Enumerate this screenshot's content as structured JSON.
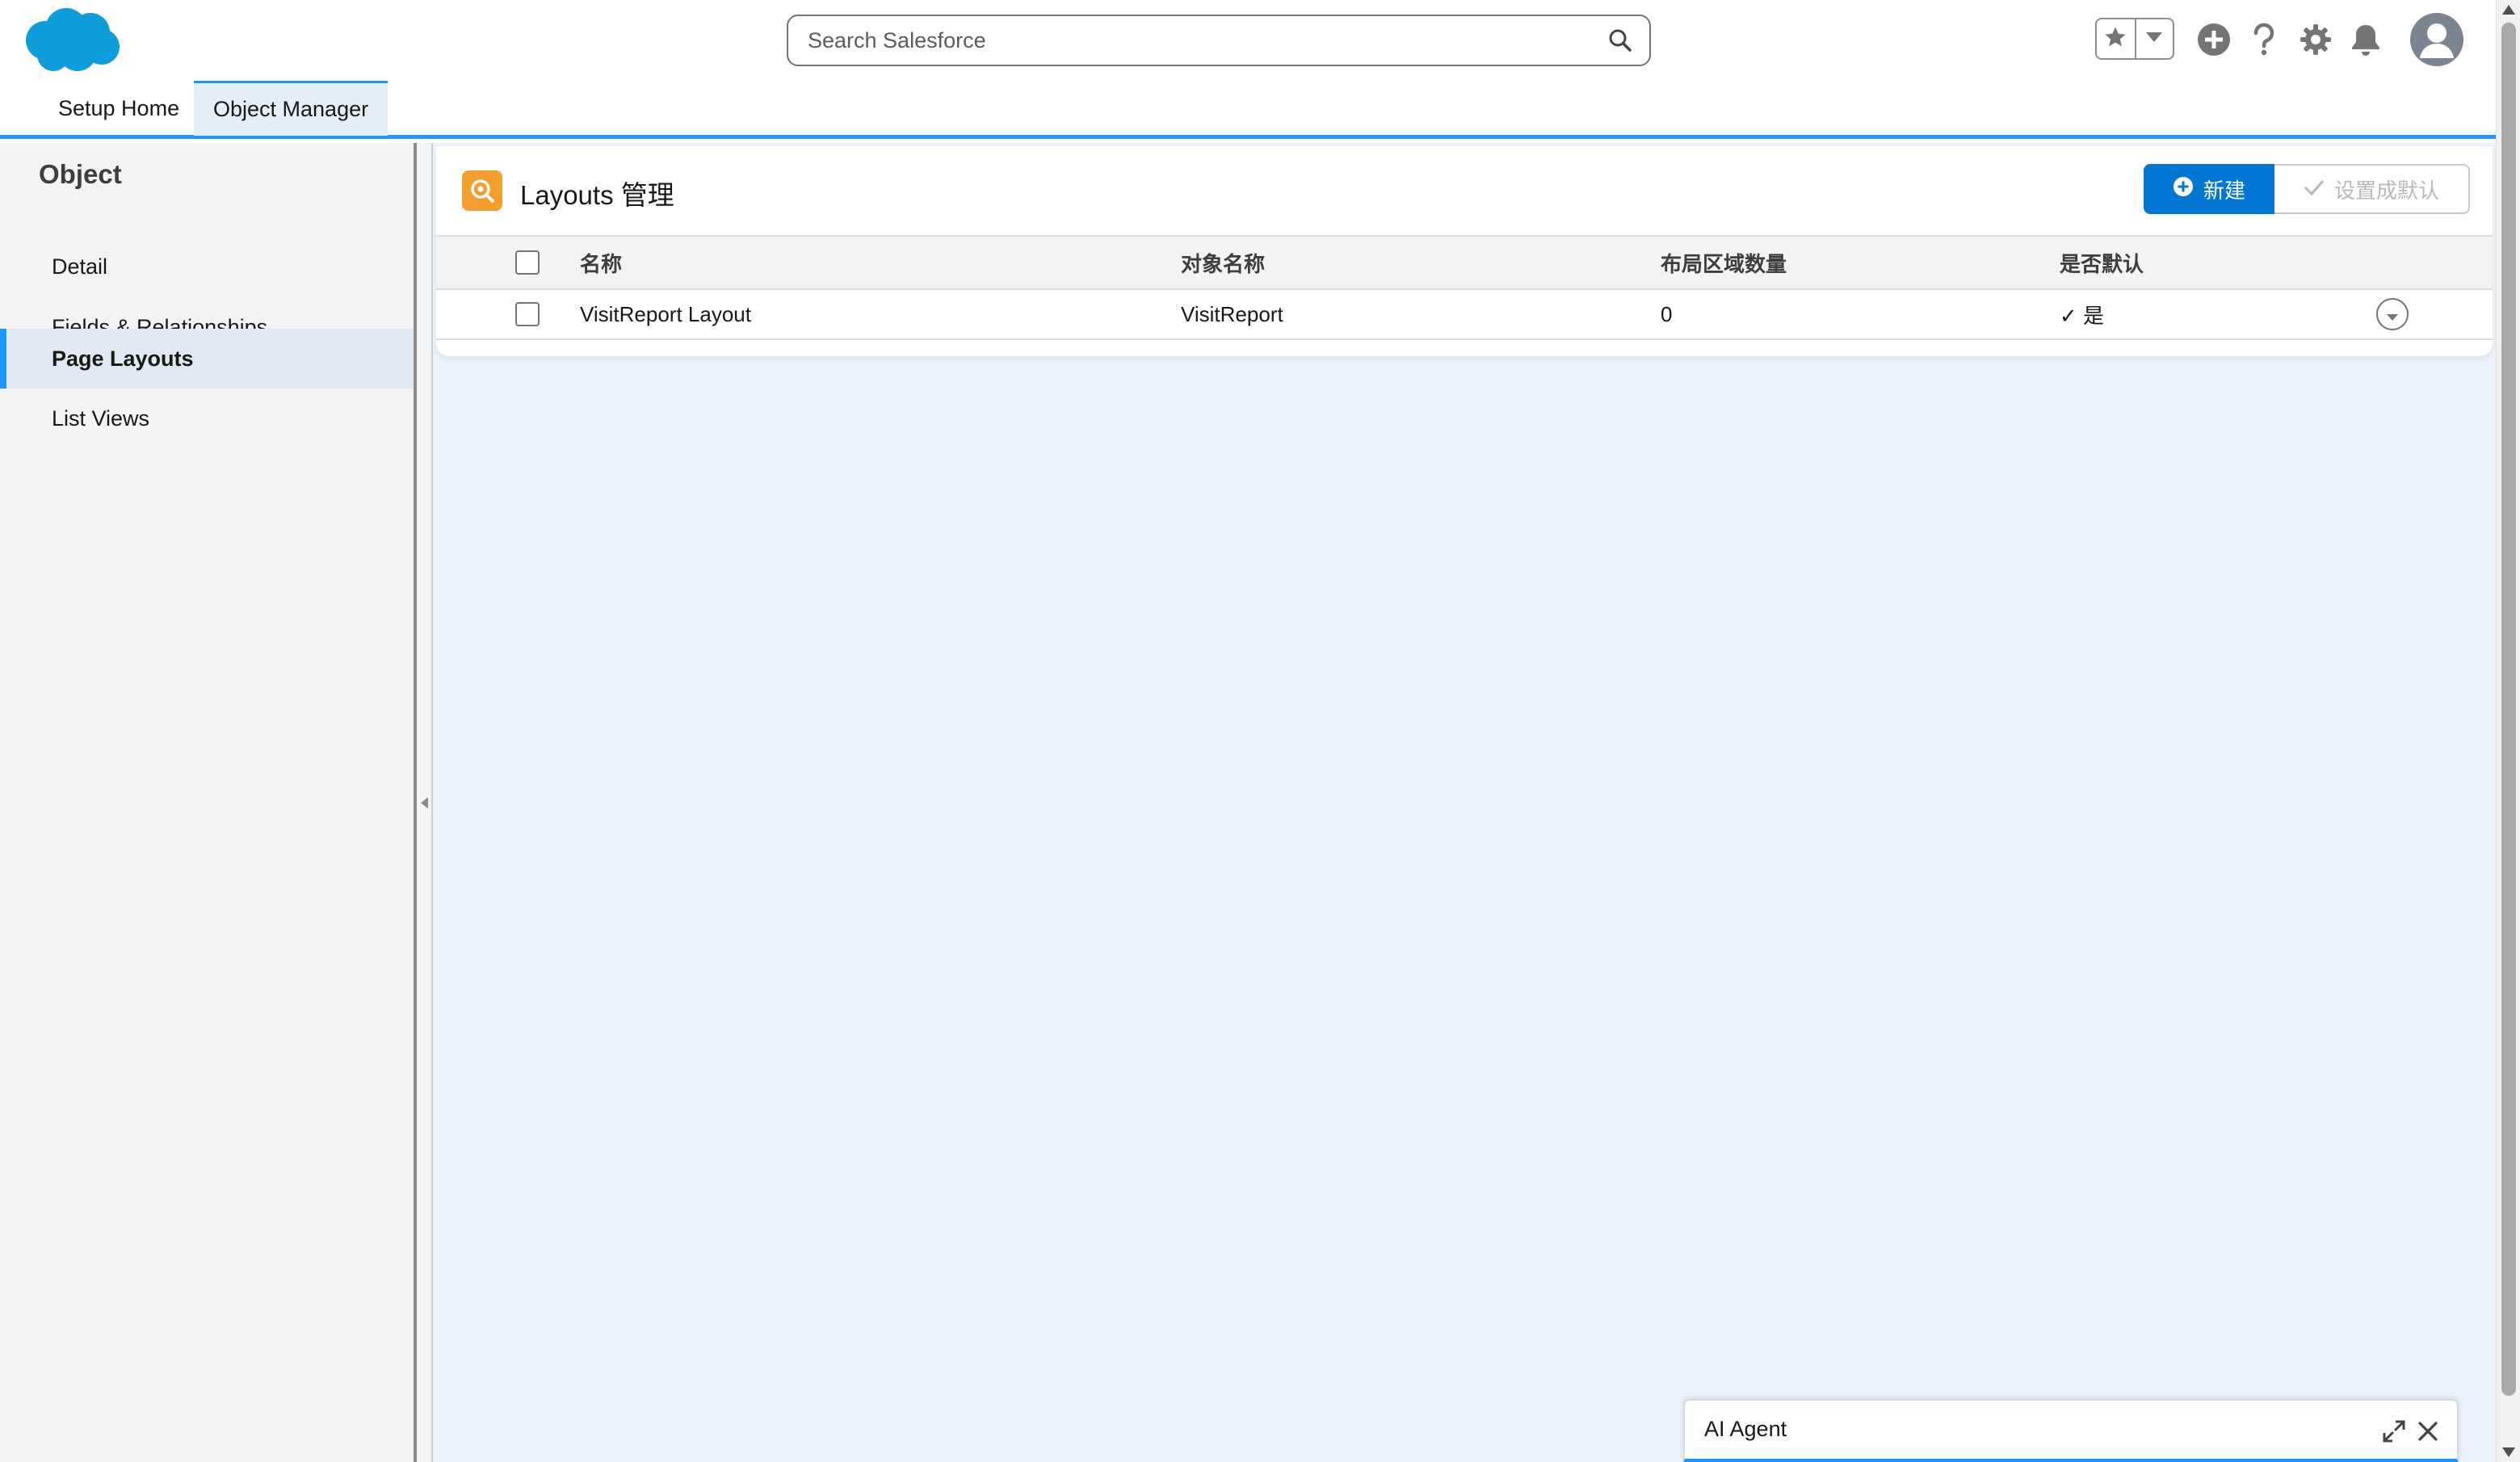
{
  "header": {
    "logo_icon": "salesforce-cloud-logo",
    "search": {
      "placeholder": "Search Salesforce"
    },
    "icons": [
      "star-icon",
      "chevron-down-icon",
      "plus-circle-icon",
      "help-icon",
      "gear-icon",
      "bell-icon",
      "user-avatar-icon"
    ]
  },
  "tabs": [
    {
      "label": "Setup Home",
      "active": false
    },
    {
      "label": "Object Manager",
      "active": true
    }
  ],
  "sidebar": {
    "title": "Object",
    "items": [
      {
        "label": "Detail",
        "active": false
      },
      {
        "label": "Fields & Relationships",
        "active": false
      },
      {
        "label": "Page Layouts",
        "active": true
      },
      {
        "label": "List Views",
        "active": false
      }
    ]
  },
  "main": {
    "title": "Layouts 管理",
    "buttons": {
      "new": "新建",
      "set_default": "设置成默认"
    },
    "table": {
      "columns": [
        "名称",
        "对象名称",
        "布局区域数量",
        "是否默认"
      ],
      "rows": [
        {
          "name": "VisitReport Layout",
          "object": "VisitReport",
          "region_count": "0",
          "is_default": "✓ 是"
        }
      ]
    }
  },
  "agent": {
    "title": "AI Agent"
  },
  "colors": {
    "brand_blue": "#0176d3",
    "accent_blue": "#1b96ff",
    "layout_icon_orange": "#f49e2e",
    "main_bg": "#ebf2fd"
  }
}
